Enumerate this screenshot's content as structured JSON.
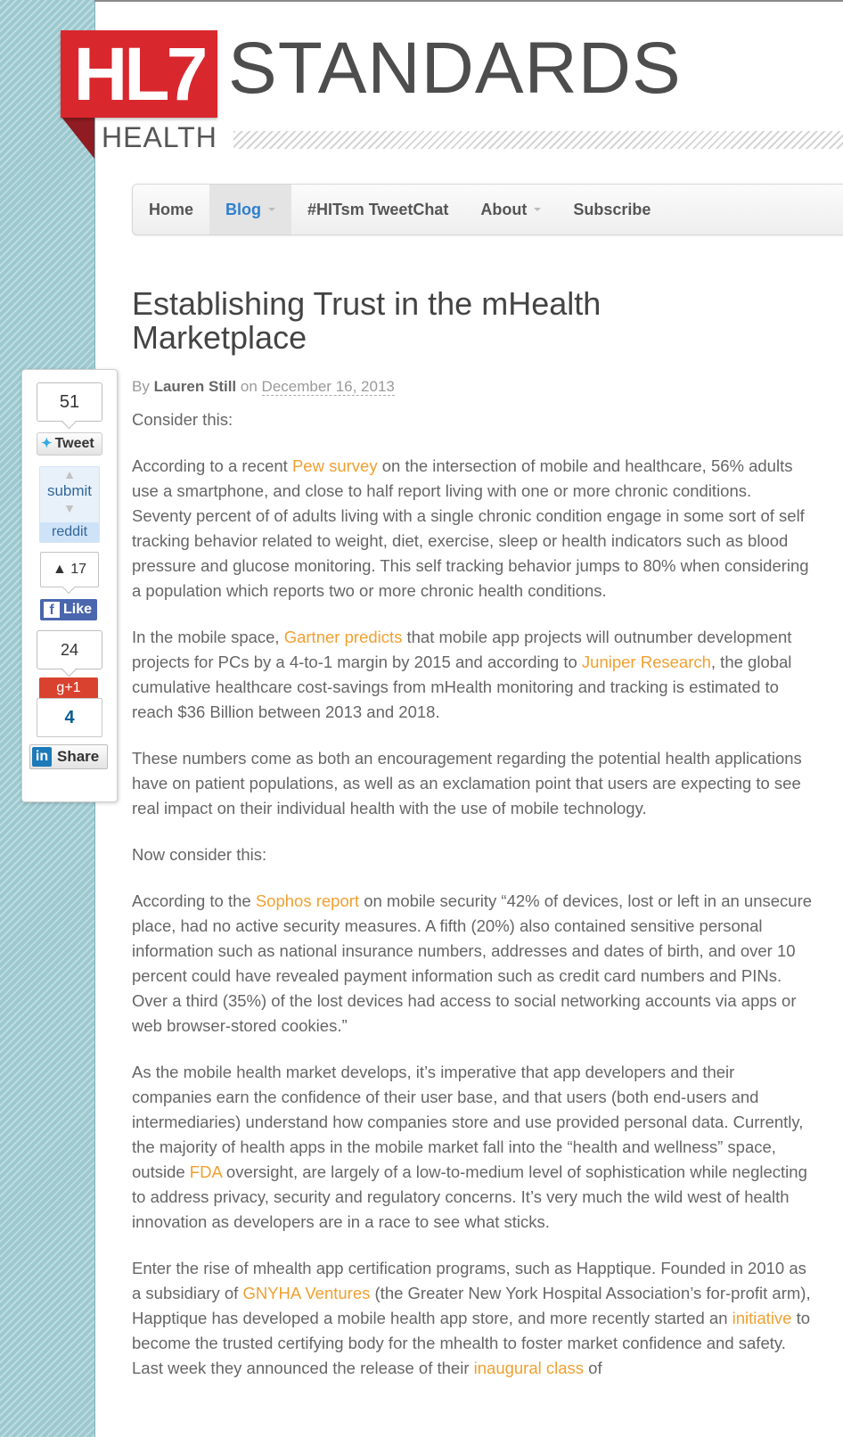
{
  "logo": {
    "mark": "HL7",
    "word": "STANDARDS",
    "sub": "HEALTH"
  },
  "nav": {
    "items": [
      {
        "label": "Home"
      },
      {
        "label": "Blog"
      },
      {
        "label": "#HITsm TweetChat"
      },
      {
        "label": "About"
      },
      {
        "label": "Subscribe"
      }
    ]
  },
  "article": {
    "title": "Establishing Trust in the mHealth Marketplace",
    "byline": {
      "by": "By",
      "author": "Lauren Still",
      "on": "on",
      "date": "December 16, 2013"
    },
    "p0": "Consider this:",
    "p1": {
      "a": "According to a recent ",
      "link1": "Pew survey",
      "b": " on the intersection of mobile and healthcare, 56% adults use a smartphone, and close to half report living with one or more chronic conditions. Seventy percent of of adults living with a single chronic condition engage in some sort of self tracking behavior related to weight, diet, exercise, sleep or health indicators such as blood pressure and glucose monitoring. This self tracking behavior jumps to 80% when considering a population which reports two or more chronic health conditions."
    },
    "p2": {
      "a": "In the mobile space, ",
      "link1": "Gartner predicts",
      "b": " that mobile app projects will outnumber development projects for PCs by a 4-to-1 margin by 2015 and according to ",
      "link2": "Juniper Research",
      "c": ", the global cumulative healthcare cost-savings from mHealth monitoring and tracking is estimated to reach $36 Billion between 2013 and 2018."
    },
    "p3": "These numbers come as both an encouragement regarding the potential health applications have on patient populations, as well as an exclamation point that users are expecting to see real impact on their individual health with the use of mobile technology.",
    "p4": "Now consider this:",
    "p5": {
      "a": "According to the ",
      "link1": "Sophos report",
      "b": " on mobile security “42% of devices, lost or left in an unsecure place, had no active security measures. A fifth (20%) also contained sensitive personal information such as national insurance numbers, addresses and dates of birth, and over 10 percent could have revealed payment information such as credit card numbers and PINs. Over a third (35%) of the lost devices had access to social networking accounts via apps or web browser-stored cookies.”"
    },
    "p6": {
      "a": "As the mobile health market develops, it’s imperative that app developers and their companies earn the confidence of their user base, and that users (both end-users and intermediaries) understand how companies store and use provided personal data. Currently, the majority of health apps in the mobile market fall into the “health and wellness” space, outside ",
      "link1": "FDA",
      "b": " oversight, are largely of a low-to-medium level of sophistication while neglecting to address privacy, security and regulatory concerns. It’s very much the wild west of health innovation as developers are in a race to see what sticks."
    },
    "p7": {
      "a": "Enter the rise of mhealth app certification programs, such as Happtique. Founded in 2010 as a subsidiary of ",
      "link1": "GNYHA Ventures",
      "b": " (the Greater New York Hospital Association’s for-profit arm), Happtique has developed a mobile health app store, and more recently started an ",
      "link2": "initiative",
      "c": " to become the trusted certifying body for the mhealth to foster market confidence and safety. Last week they announced the release of their ",
      "link3": "inaugural class",
      "d": " of"
    }
  },
  "share": {
    "tweet_count": "51",
    "tweet_label": "Tweet",
    "reddit_submit": "submit",
    "reddit_brand": "reddit",
    "fb_count": "17",
    "fb_label": "Like",
    "gplus_count": "24",
    "gplus_label": "+1",
    "linkedin_count": "4",
    "linkedin_label": "Share"
  },
  "colors": {
    "accent_link": "#f0a030",
    "nav_active": "#2f7fcf",
    "logo_red": "#d9272e",
    "rail": "#9cc9cf"
  }
}
